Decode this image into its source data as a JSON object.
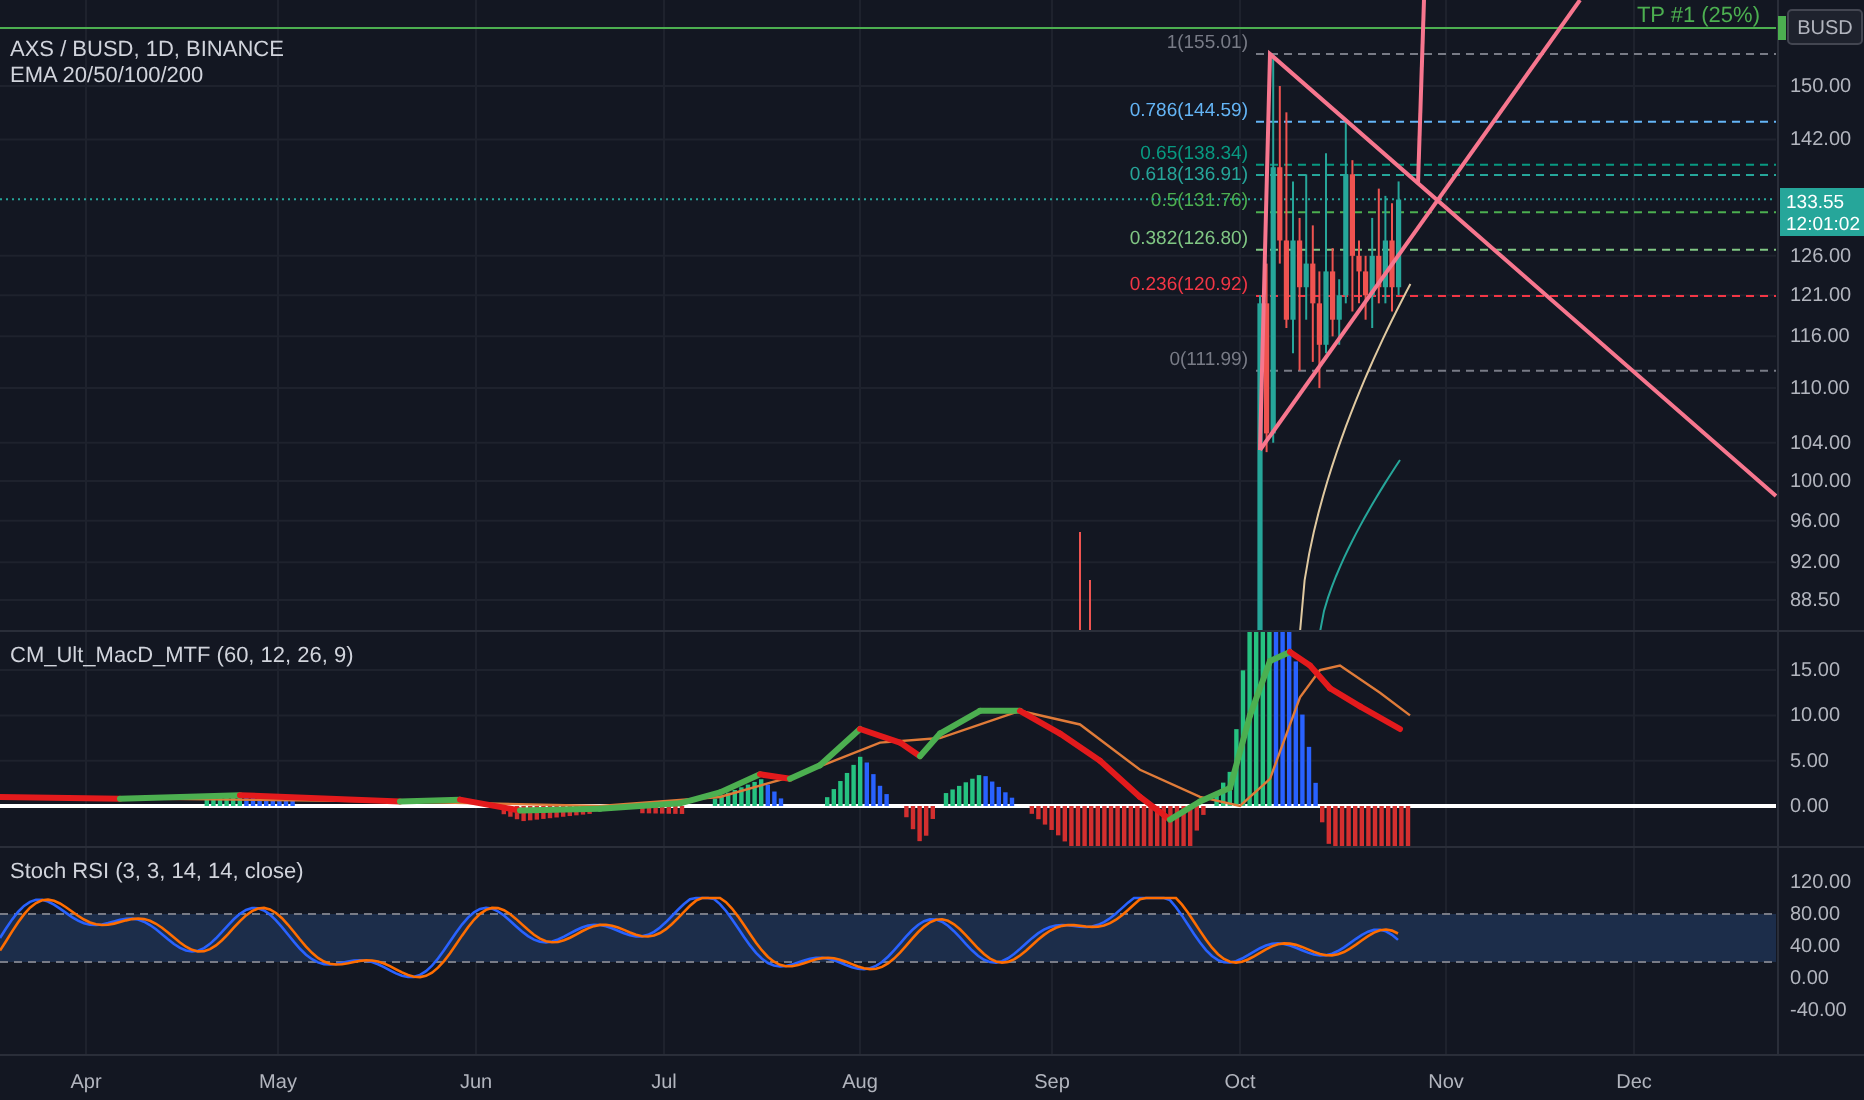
{
  "header": {
    "symbol": "AXS / BUSD, 1D, BINANCE",
    "indicator": "EMA 20/50/100/200"
  },
  "target_line": {
    "label": "TP #1 (25%)"
  },
  "price_axis": {
    "currency": "BUSD",
    "ticks": [
      "150.00",
      "142.00",
      "126.00",
      "121.00",
      "116.00",
      "110.00",
      "104.00",
      "100.00",
      "96.00",
      "92.00",
      "88.50"
    ],
    "last_price": "133.55",
    "countdown": "12:01:02"
  },
  "fib_levels": [
    {
      "label": "1(155.01)",
      "color": "#787b86"
    },
    {
      "label": "0.786(144.59)",
      "color": "#64b5f6"
    },
    {
      "label": "0.65(138.34)",
      "color": "#089981"
    },
    {
      "label": "0.618(136.91)",
      "color": "#26a69a"
    },
    {
      "label": "0.5(131.76)",
      "color": "#4caf50"
    },
    {
      "label": "0.382(126.80)",
      "color": "#81c784"
    },
    {
      "label": "0.236(120.92)",
      "color": "#f23645"
    },
    {
      "label": "0(111.99)",
      "color": "#787b86"
    }
  ],
  "macd_pane": {
    "title": "CM_Ult_MacD_MTF (60, 12, 26, 9)",
    "ticks": [
      "15.00",
      "10.00",
      "5.00",
      "0.00"
    ]
  },
  "stoch_pane": {
    "title": "Stoch RSI (3, 3, 14, 14, close)",
    "ticks": [
      "120.00",
      "80.00",
      "40.00",
      "0.00",
      "-40.00"
    ]
  },
  "time_axis": [
    "Apr",
    "May",
    "Jun",
    "Jul",
    "Aug",
    "Sep",
    "Oct",
    "Nov",
    "Dec"
  ]
}
